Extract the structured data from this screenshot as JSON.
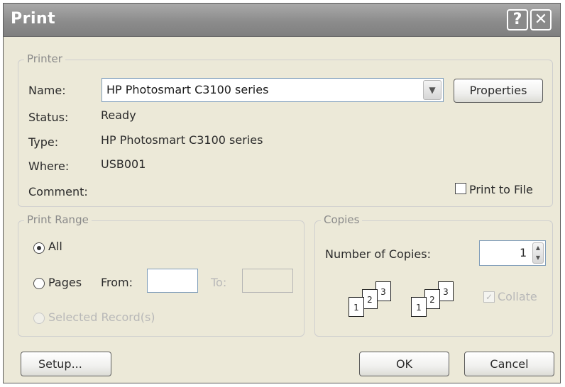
{
  "dialog": {
    "title": "Print",
    "help_glyph": "?",
    "close_glyph": "✕"
  },
  "printer": {
    "legend": "Printer",
    "name_label": "Name:",
    "name_value": "HP Photosmart C3100 series",
    "properties_button": "Properties",
    "status_label": "Status:",
    "status_value": "Ready",
    "type_label": "Type:",
    "type_value": "HP Photosmart C3100 series",
    "where_label": "Where:",
    "where_value": "USB001",
    "comment_label": "Comment:",
    "print_to_file_label": "Print to File"
  },
  "print_range": {
    "legend": "Print Range",
    "all_label": "All",
    "pages_label": "Pages",
    "from_label": "From:",
    "to_label": "To:",
    "selected_label": "Selected Record(s)"
  },
  "copies": {
    "legend": "Copies",
    "number_label": "Number of Copies:",
    "number_value": "1",
    "collate_label": "Collate",
    "page_labels": [
      "1",
      "2",
      "3"
    ]
  },
  "buttons": {
    "setup": "Setup...",
    "ok": "OK",
    "cancel": "Cancel"
  }
}
